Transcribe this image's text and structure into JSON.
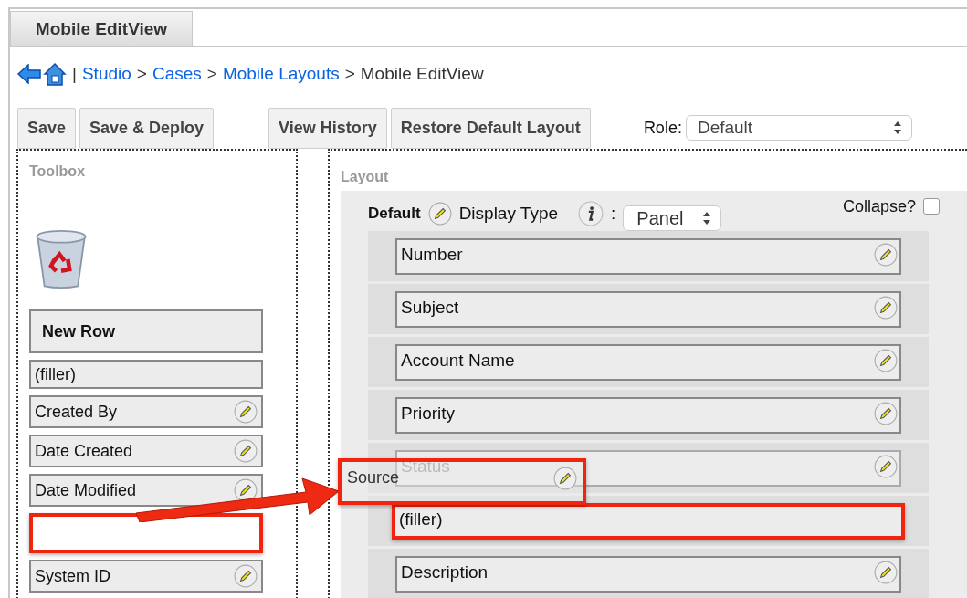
{
  "tab": {
    "label": "Mobile EditView",
    "selected": true
  },
  "breadcrumb": {
    "separator": "|",
    "links": [
      "Studio",
      "Cases",
      "Mobile Layouts"
    ],
    "arrow": ">",
    "current": "Mobile EditView"
  },
  "buttons_left": [
    "Save",
    "Save & Deploy"
  ],
  "buttons_right": [
    "View History",
    "Restore Default Layout"
  ],
  "role": {
    "label": "Role:",
    "value": "Default"
  },
  "toolbox": {
    "title": "Toolbox",
    "items": [
      {
        "kind": "row",
        "label": "New Row",
        "highlighted": false
      },
      {
        "kind": "filler",
        "label": "(filler)",
        "highlighted": false
      },
      {
        "kind": "field",
        "label": "Created By",
        "highlighted": false
      },
      {
        "kind": "field",
        "label": "Date Created",
        "highlighted": false
      },
      {
        "kind": "field",
        "label": "Date Modified",
        "highlighted": false
      },
      {
        "kind": "empty",
        "highlighted": true
      },
      {
        "kind": "field",
        "label": "System ID",
        "highlighted": false
      }
    ]
  },
  "layout": {
    "title": "Layout",
    "panel_name": "Default",
    "display_type_label": "Display Type",
    "colon": ":",
    "display_type": "Panel",
    "collapse_label": "Collapse?",
    "collapse_checked": false,
    "rows": [
      {
        "kind": "field",
        "label": "Number",
        "highlighted": false,
        "faded": false
      },
      {
        "kind": "field",
        "label": "Subject",
        "highlighted": false,
        "faded": false
      },
      {
        "kind": "field",
        "label": "Account Name",
        "highlighted": false,
        "faded": false
      },
      {
        "kind": "field",
        "label": "Priority",
        "highlighted": false,
        "faded": false
      },
      {
        "kind": "field",
        "label": "Status",
        "highlighted": false,
        "faded": true
      },
      {
        "kind": "filler",
        "label": "(filler)",
        "highlighted": true,
        "faded": false
      },
      {
        "kind": "field",
        "label": "Description",
        "highlighted": false,
        "faded": false
      }
    ],
    "dragged_item": {
      "label": "Source",
      "highlighted": true
    }
  }
}
